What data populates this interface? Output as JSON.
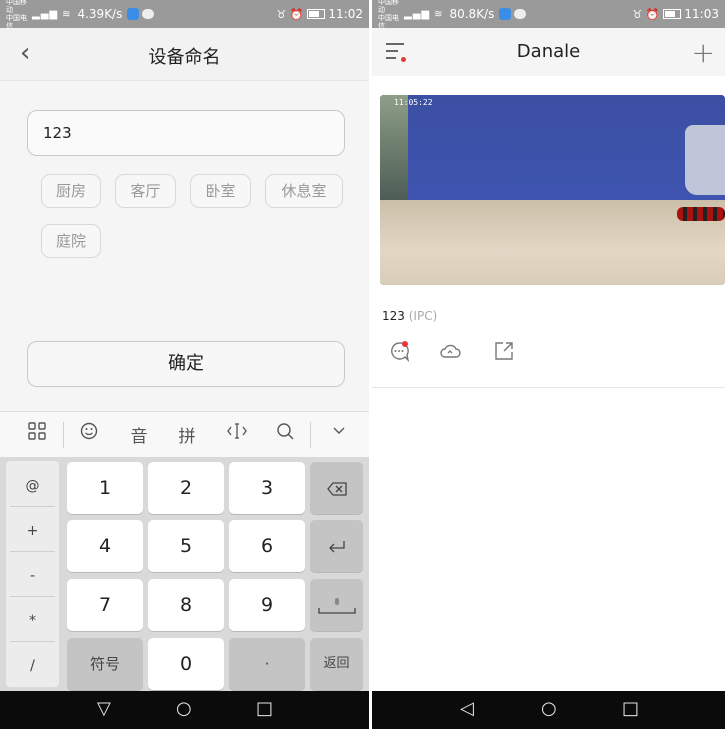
{
  "left": {
    "statusbar": {
      "carrier1": "中国移动",
      "carrier2": "中国电信",
      "speed": "4.39K/s",
      "time": "11:02"
    },
    "title": "设备命名",
    "input_value": "123",
    "chips": [
      "厨房",
      "客厅",
      "卧室",
      "休息室",
      "庭院"
    ],
    "confirm_label": "确定",
    "keyboard": {
      "toolbar": [
        "音",
        "拼"
      ],
      "side_keys": [
        "@",
        "+",
        "-",
        "*",
        "/"
      ],
      "keys": [
        "1",
        "2",
        "3",
        "4",
        "5",
        "6",
        "7",
        "8",
        "9"
      ],
      "symbol_label": "符号",
      "zero": "0",
      "dot": "·",
      "return_label": "返回"
    }
  },
  "right": {
    "statusbar": {
      "carrier1": "中国移动",
      "carrier2": "中国电信",
      "speed": "80.8K/s",
      "time": "11:03"
    },
    "title": "Danale",
    "camera_timestamp": "11:05:22",
    "device_name": "123",
    "device_type": "(IPC)"
  }
}
